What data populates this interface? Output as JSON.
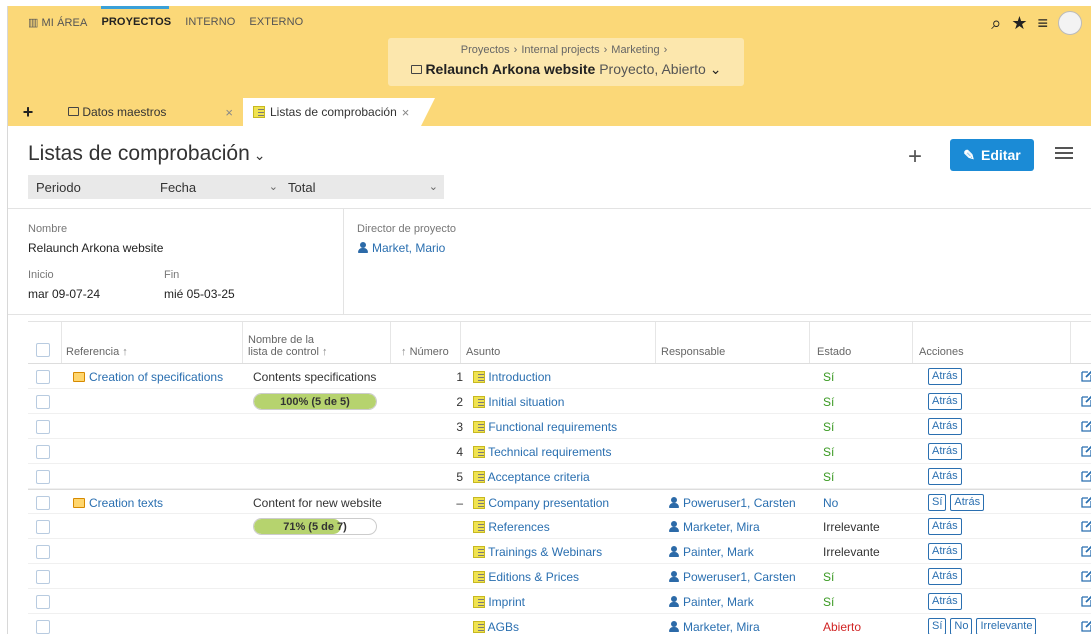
{
  "nav": {
    "items": [
      "MI ÁREA",
      "PROYECTOS",
      "INTERNO",
      "EXTERNO"
    ],
    "active": "PROYECTOS"
  },
  "breadcrumb": {
    "crumbs": [
      "Proyectos",
      "Internal projects",
      "Marketing"
    ],
    "project_name": "Relaunch Arkona website",
    "project_status": "Proyecto, Abierto"
  },
  "tabs": {
    "add": "+",
    "tab1": "Datos maestros",
    "tab2": "Listas de comprobación",
    "close": "×"
  },
  "page": {
    "title": "Listas de comprobación",
    "edit_label": "Editar",
    "plus": "+"
  },
  "filters": {
    "periodo": "Periodo",
    "fecha": "Fecha",
    "total": "Total"
  },
  "info": {
    "nombre_label": "Nombre",
    "nombre_value": "Relaunch Arkona website",
    "inicio_label": "Inicio",
    "inicio_value": "mar 09-07-24",
    "fin_label": "Fin",
    "fin_value": "mié 05-03-25",
    "director_label": "Director de proyecto",
    "director_value": "Market, Mario"
  },
  "table": {
    "headers": {
      "referencia": "Referencia",
      "control": "Nombre de la lista de control",
      "control_line1": "Nombre de la",
      "control_line2": "lista de control",
      "numero": "Número",
      "asunto": "Asunto",
      "responsable": "Responsable",
      "estado": "Estado",
      "acciones": "Acciones"
    },
    "rows": [
      {
        "ref": "Creation of specifications",
        "control": "Contents specifications",
        "num": "1",
        "subject": "Introduction",
        "resp": "",
        "status": "Sí",
        "status_kind": "si",
        "actions": [
          "Atrás"
        ]
      },
      {
        "ref": "",
        "control": "",
        "progress_text": "100% (5 de 5)",
        "progress": 1.0,
        "num": "2",
        "subject": "Initial situation",
        "resp": "",
        "status": "Sí",
        "status_kind": "si",
        "actions": [
          "Atrás"
        ]
      },
      {
        "ref": "",
        "control": "",
        "num": "3",
        "subject": "Functional requirements",
        "resp": "",
        "status": "Sí",
        "status_kind": "si",
        "actions": [
          "Atrás"
        ]
      },
      {
        "ref": "",
        "control": "",
        "num": "4",
        "subject": "Technical requirements",
        "resp": "",
        "status": "Sí",
        "status_kind": "si",
        "actions": [
          "Atrás"
        ]
      },
      {
        "ref": "",
        "control": "",
        "num": "5",
        "subject": "Acceptance criteria",
        "resp": "",
        "status": "Sí",
        "status_kind": "si",
        "actions": [
          "Atrás"
        ]
      },
      {
        "ref": "Creation texts",
        "control": "Content for new website",
        "num": "–",
        "subject": "Company presentation",
        "resp": "Poweruser1, Carsten",
        "status": "No",
        "status_kind": "no",
        "actions": [
          "Sí",
          "Atrás"
        ],
        "group_start": true
      },
      {
        "ref": "",
        "control": "",
        "progress_text": "71% (5 de 7)",
        "progress": 0.71,
        "num": "",
        "subject": "References",
        "resp": "Marketer, Mira",
        "status": "Irrelevante",
        "status_kind": "irr",
        "actions": [
          "Atrás"
        ]
      },
      {
        "ref": "",
        "control": "",
        "num": "",
        "subject": "Trainings & Webinars",
        "resp": "Painter, Mark",
        "status": "Irrelevante",
        "status_kind": "irr",
        "actions": [
          "Atrás"
        ]
      },
      {
        "ref": "",
        "control": "",
        "num": "",
        "subject": "Editions & Prices",
        "resp": "Poweruser1, Carsten",
        "status": "Sí",
        "status_kind": "si",
        "actions": [
          "Atrás"
        ]
      },
      {
        "ref": "",
        "control": "",
        "num": "",
        "subject": "Imprint",
        "resp": "Painter, Mark",
        "status": "Sí",
        "status_kind": "si",
        "actions": [
          "Atrás"
        ]
      },
      {
        "ref": "",
        "control": "",
        "num": "",
        "subject": "AGBs",
        "resp": "Marketer, Mira",
        "status": "Abierto",
        "status_kind": "ab",
        "actions": [
          "Sí",
          "No",
          "Irrelevante"
        ]
      }
    ]
  }
}
